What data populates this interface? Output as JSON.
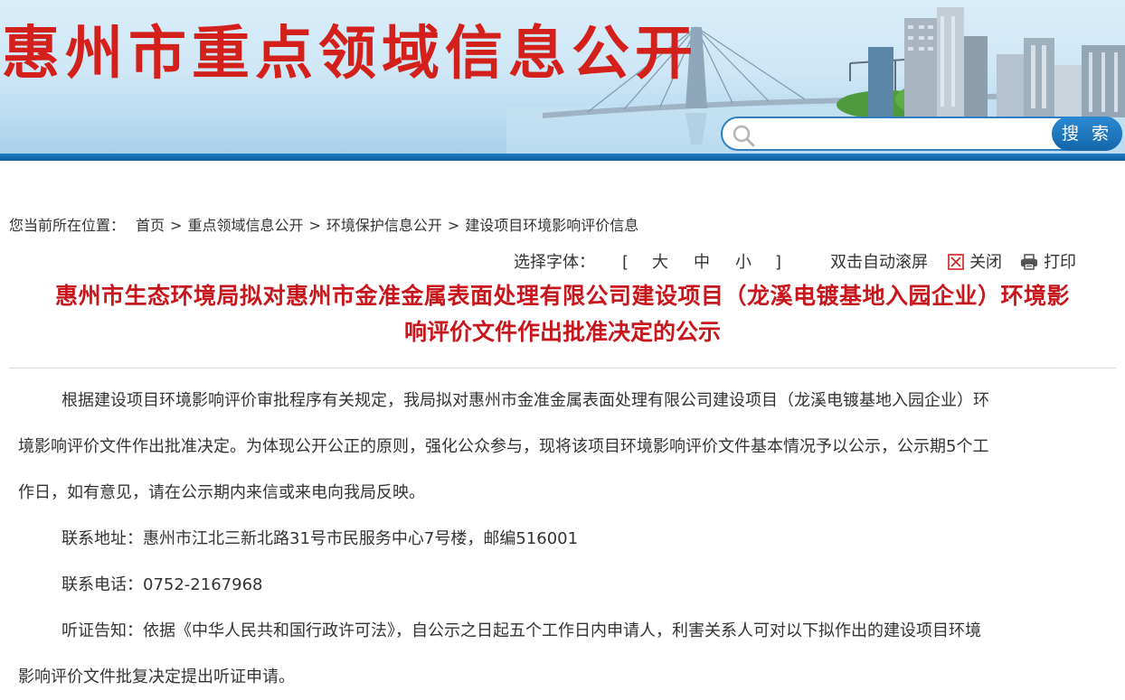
{
  "banner": {
    "title": "惠州市重点领域信息公开",
    "search_placeholder": "",
    "search_button": "搜 索"
  },
  "breadcrumb": {
    "prefix": "您当前所在位置：",
    "items": [
      "首页",
      "重点领域信息公开",
      "环境保护信息公开",
      "建设项目环境影响评价信息"
    ],
    "separator": ">"
  },
  "tools": {
    "font_label": "选择字体：",
    "open_bracket": "[",
    "sizes": [
      "大",
      "中",
      "小"
    ],
    "close_bracket": "]",
    "auto_scroll": "双击自动滚屏",
    "close": "关闭",
    "print": "打印"
  },
  "article": {
    "title_line1": "惠州市生态环境局拟对惠州市金准金属表面处理有限公司建设项目（龙溪电镀基地入园企业）环境影",
    "title_line2": "响评价文件作出批准决定的公示",
    "p1_line1": "根据建设项目环境影响评价审批程序有关规定，我局拟对惠州市金准金属表面处理有限公司建设项目（龙溪电镀基地入园企业）环",
    "p1_line2": "境影响评价文件作出批准决定。为体现公开公正的原则，强化公众参与，现将该项目环境影响评价文件基本情况予以公示，公示期5个工",
    "p1_line3": "作日，如有意见，请在公示期内来信或来电向我局反映。",
    "address": "联系地址：惠州市江北三新北路31号市民服务中心7号楼，邮编516001",
    "phone": "联系电话：0752-2167968",
    "hearing_line1": "听证告知：依据《中华人民共和国行政许可法》，自公示之日起五个工作日内申请人，利害关系人可对以下拟作出的建设项目环境",
    "hearing_line2": "影响评价文件批复决定提出听证申请。"
  },
  "colors": {
    "banner_title": "#d4201a",
    "article_title": "#c8161d",
    "accent_blue": "#1f7cc0",
    "body_text": "#333333"
  },
  "icons": {
    "search": "magnifier-icon",
    "close": "close-box-icon",
    "print": "printer-icon"
  }
}
